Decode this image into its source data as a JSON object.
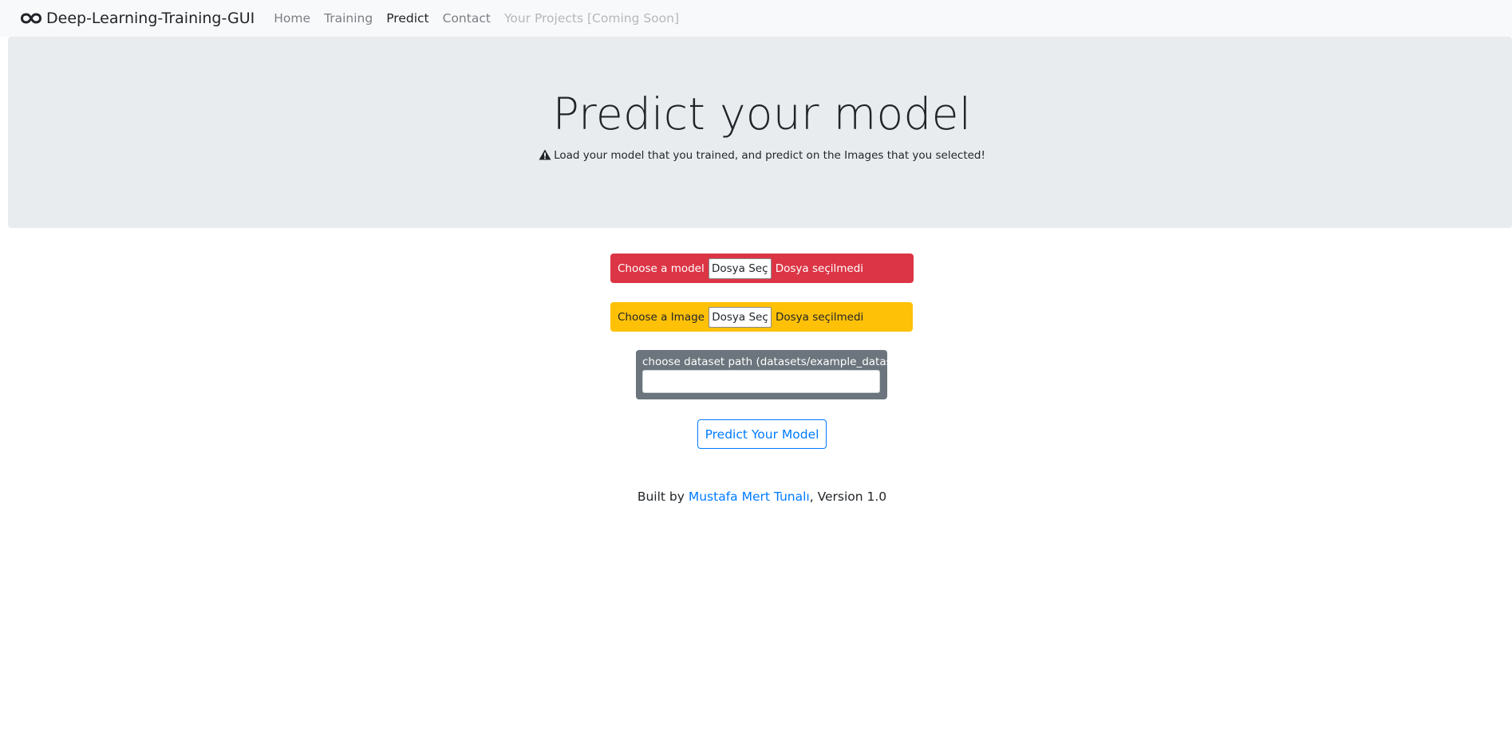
{
  "navbar": {
    "brand": "Deep-Learning-Training-GUI",
    "brand_icon": "infinity-icon",
    "links": [
      {
        "label": "Home"
      },
      {
        "label": "Training"
      },
      {
        "label": "Predict"
      },
      {
        "label": "Contact"
      },
      {
        "label": "Your Projects [Coming Soon]"
      }
    ]
  },
  "hero": {
    "title": "Predict your model",
    "lead_icon": "warning-icon",
    "lead": "Load your model that you trained, and predict on the Images that you selected!"
  },
  "model_file": {
    "label": "Choose a model",
    "button": "Dosya Seç",
    "status": "Dosya seçilmedi",
    "color": "#dc3545"
  },
  "image_file": {
    "label": "Choose a Image",
    "button": "Dosya Seç",
    "status": "Dosya seçilmedi",
    "color": "#ffc107"
  },
  "dataset_path": {
    "label": "choose dataset path (datasets/example_dataset)",
    "value": "",
    "color": "#6c757d"
  },
  "predict_button": {
    "label": "Predict Your Model",
    "color": "#007bff"
  },
  "footer": {
    "prefix": "Built by ",
    "author": "Mustafa Mert Tunalı",
    "suffix": ", Version 1.0"
  }
}
